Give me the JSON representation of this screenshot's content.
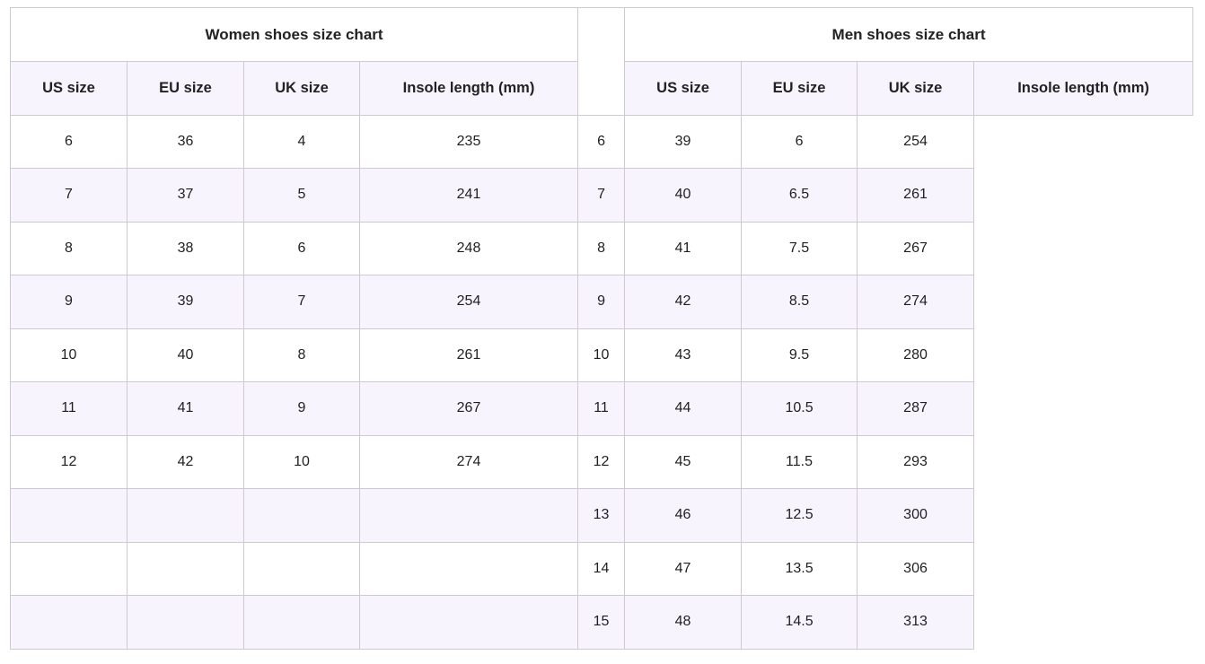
{
  "women": {
    "title": "Women shoes size chart",
    "headers": [
      "US size",
      "EU size",
      "UK size",
      "Insole length (mm)"
    ],
    "rows": [
      [
        "6",
        "36",
        "4",
        "235"
      ],
      [
        "7",
        "37",
        "5",
        "241"
      ],
      [
        "8",
        "38",
        "6",
        "248"
      ],
      [
        "9",
        "39",
        "7",
        "254"
      ],
      [
        "10",
        "40",
        "8",
        "261"
      ],
      [
        "11",
        "41",
        "9",
        "267"
      ],
      [
        "12",
        "42",
        "10",
        "274"
      ],
      [
        "",
        "",
        "",
        ""
      ],
      [
        "",
        "",
        "",
        ""
      ],
      [
        "",
        "",
        "",
        ""
      ]
    ]
  },
  "men": {
    "title": "Men shoes size chart",
    "headers": [
      "US size",
      "EU size",
      "UK size",
      "Insole length (mm)"
    ],
    "rows": [
      [
        "6",
        "39",
        "6",
        "254"
      ],
      [
        "7",
        "40",
        "6.5",
        "261"
      ],
      [
        "8",
        "41",
        "7.5",
        "267"
      ],
      [
        "9",
        "42",
        "8.5",
        "274"
      ],
      [
        "10",
        "43",
        "9.5",
        "280"
      ],
      [
        "11",
        "44",
        "10.5",
        "287"
      ],
      [
        "12",
        "45",
        "11.5",
        "293"
      ],
      [
        "13",
        "46",
        "12.5",
        "300"
      ],
      [
        "14",
        "47",
        "13.5",
        "306"
      ],
      [
        "15",
        "48",
        "14.5",
        "313"
      ]
    ]
  }
}
